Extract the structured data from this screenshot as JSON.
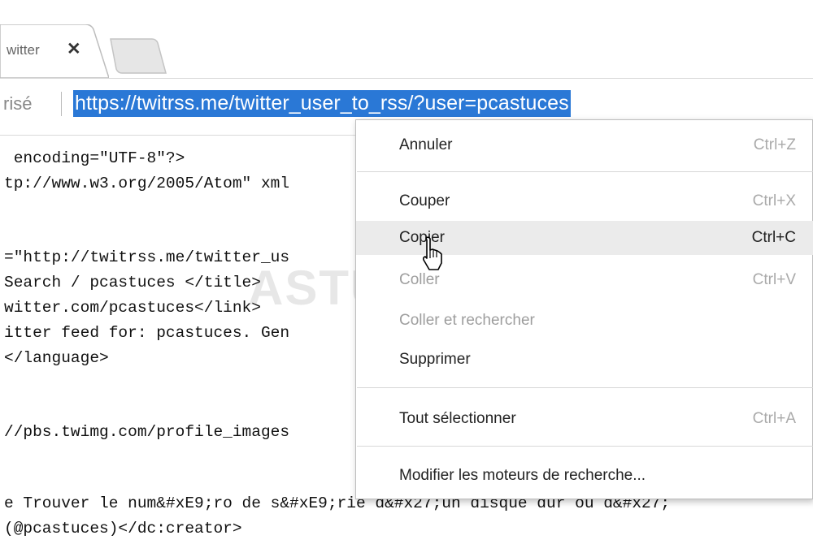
{
  "tab": {
    "title": "witter",
    "close_icon": "close-icon"
  },
  "omnibox": {
    "security_text": "risé",
    "url": "https://twitrss.me/twitter_user_to_rss/?user=pcastuces"
  },
  "source_lines": [
    " encoding=\"UTF-8\"?>",
    "tp://www.w3.org/2005/Atom\" xml",
    "",
    "=\"http://twitrss.me/twitter_us",
    "Search / pcastuces </title>",
    "witter.com/pcastuces</link>",
    "itter feed for: pcastuces. Gen",
    "</language>",
    "",
    "//pbs.twimg.com/profile_images",
    "",
    "e Trouver le num&#xE9;ro de s&#xE9;rie d&#x27;un disque dur ou d&#x27;",
    "(@pcastuces)</dc:creator>"
  ],
  "watermark": "ASTUCES",
  "context_menu": {
    "items": [
      {
        "label": "Annuler",
        "shortcut": "Ctrl+Z",
        "state": "enabled"
      },
      {
        "label": "Couper",
        "shortcut": "Ctrl+X",
        "state": "enabled"
      },
      {
        "label": "Copier",
        "shortcut": "Ctrl+C",
        "state": "hover"
      },
      {
        "label": "Coller",
        "shortcut": "Ctrl+V",
        "state": "disabled"
      },
      {
        "label": "Coller et rechercher",
        "shortcut": "",
        "state": "disabled"
      },
      {
        "label": "Supprimer",
        "shortcut": "",
        "state": "enabled"
      },
      {
        "label": "Tout sélectionner",
        "shortcut": "Ctrl+A",
        "state": "enabled"
      },
      {
        "label": "Modifier les moteurs de recherche...",
        "shortcut": "",
        "state": "enabled"
      }
    ]
  },
  "colors": {
    "selection": "#2a78d6",
    "hover": "#ebebeb"
  }
}
